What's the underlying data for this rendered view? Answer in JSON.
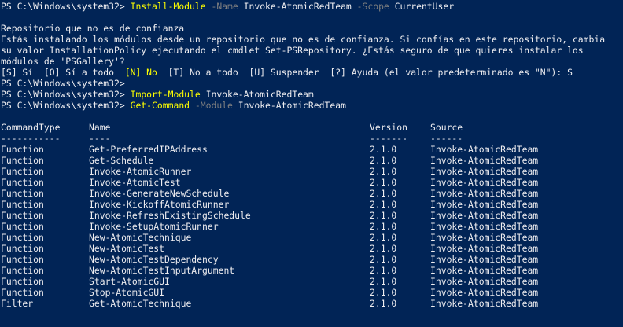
{
  "prompt": "PS C:\\Windows\\system32> ",
  "cmd1": {
    "name": "Install-Module",
    "p1": "-Name",
    "a1": "Invoke-AtomicRedTeam",
    "p2": "-Scope",
    "a2": "CurrentUser"
  },
  "warning": {
    "title": "Repositorio que no es de confianza",
    "line1": "Estás instalando los módulos desde un repositorio que no es de confianza. Si confías en este repositorio, cambia",
    "line2": "su valor InstallationPolicy ejecutando el cmdlet Set-PSRepository. ¿Estás seguro de que quieres instalar los",
    "line3": "módulos de 'PSGallery'?",
    "opt_pre": "[S] Sí  [O] Sí a todo  ",
    "opt_no": "[N] No",
    "opt_post": "  [T] No a todo  [U] Suspender  [?] Ayuda (el valor predeterminado es \"N\"): S"
  },
  "cmd2": {
    "name": "Import-Module",
    "a1": "Invoke-AtomicRedTeam"
  },
  "cmd3": {
    "name": "Get-Command",
    "p1": "-Module",
    "a1": "Invoke-AtomicRedTeam"
  },
  "table": {
    "headers": [
      "CommandType",
      "Name",
      "Version",
      "Source"
    ],
    "underline": [
      "-----------",
      "----",
      "-------",
      "------"
    ],
    "rows": [
      [
        "Function",
        "Get-PreferredIPAddress",
        "2.1.0",
        "Invoke-AtomicRedTeam"
      ],
      [
        "Function",
        "Get-Schedule",
        "2.1.0",
        "Invoke-AtomicRedTeam"
      ],
      [
        "Function",
        "Invoke-AtomicRunner",
        "2.1.0",
        "Invoke-AtomicRedTeam"
      ],
      [
        "Function",
        "Invoke-AtomicTest",
        "2.1.0",
        "Invoke-AtomicRedTeam"
      ],
      [
        "Function",
        "Invoke-GenerateNewSchedule",
        "2.1.0",
        "Invoke-AtomicRedTeam"
      ],
      [
        "Function",
        "Invoke-KickoffAtomicRunner",
        "2.1.0",
        "Invoke-AtomicRedTeam"
      ],
      [
        "Function",
        "Invoke-RefreshExistingSchedule",
        "2.1.0",
        "Invoke-AtomicRedTeam"
      ],
      [
        "Function",
        "Invoke-SetupAtomicRunner",
        "2.1.0",
        "Invoke-AtomicRedTeam"
      ],
      [
        "Function",
        "New-AtomicTechnique",
        "2.1.0",
        "Invoke-AtomicRedTeam"
      ],
      [
        "Function",
        "New-AtomicTest",
        "2.1.0",
        "Invoke-AtomicRedTeam"
      ],
      [
        "Function",
        "New-AtomicTestDependency",
        "2.1.0",
        "Invoke-AtomicRedTeam"
      ],
      [
        "Function",
        "New-AtomicTestInputArgument",
        "2.1.0",
        "Invoke-AtomicRedTeam"
      ],
      [
        "Function",
        "Start-AtomicGUI",
        "2.1.0",
        "Invoke-AtomicRedTeam"
      ],
      [
        "Function",
        "Stop-AtomicGUI",
        "2.1.0",
        "Invoke-AtomicRedTeam"
      ],
      [
        "Filter",
        "Get-AtomicTechnique",
        "2.1.0",
        "Invoke-AtomicRedTeam"
      ]
    ]
  }
}
